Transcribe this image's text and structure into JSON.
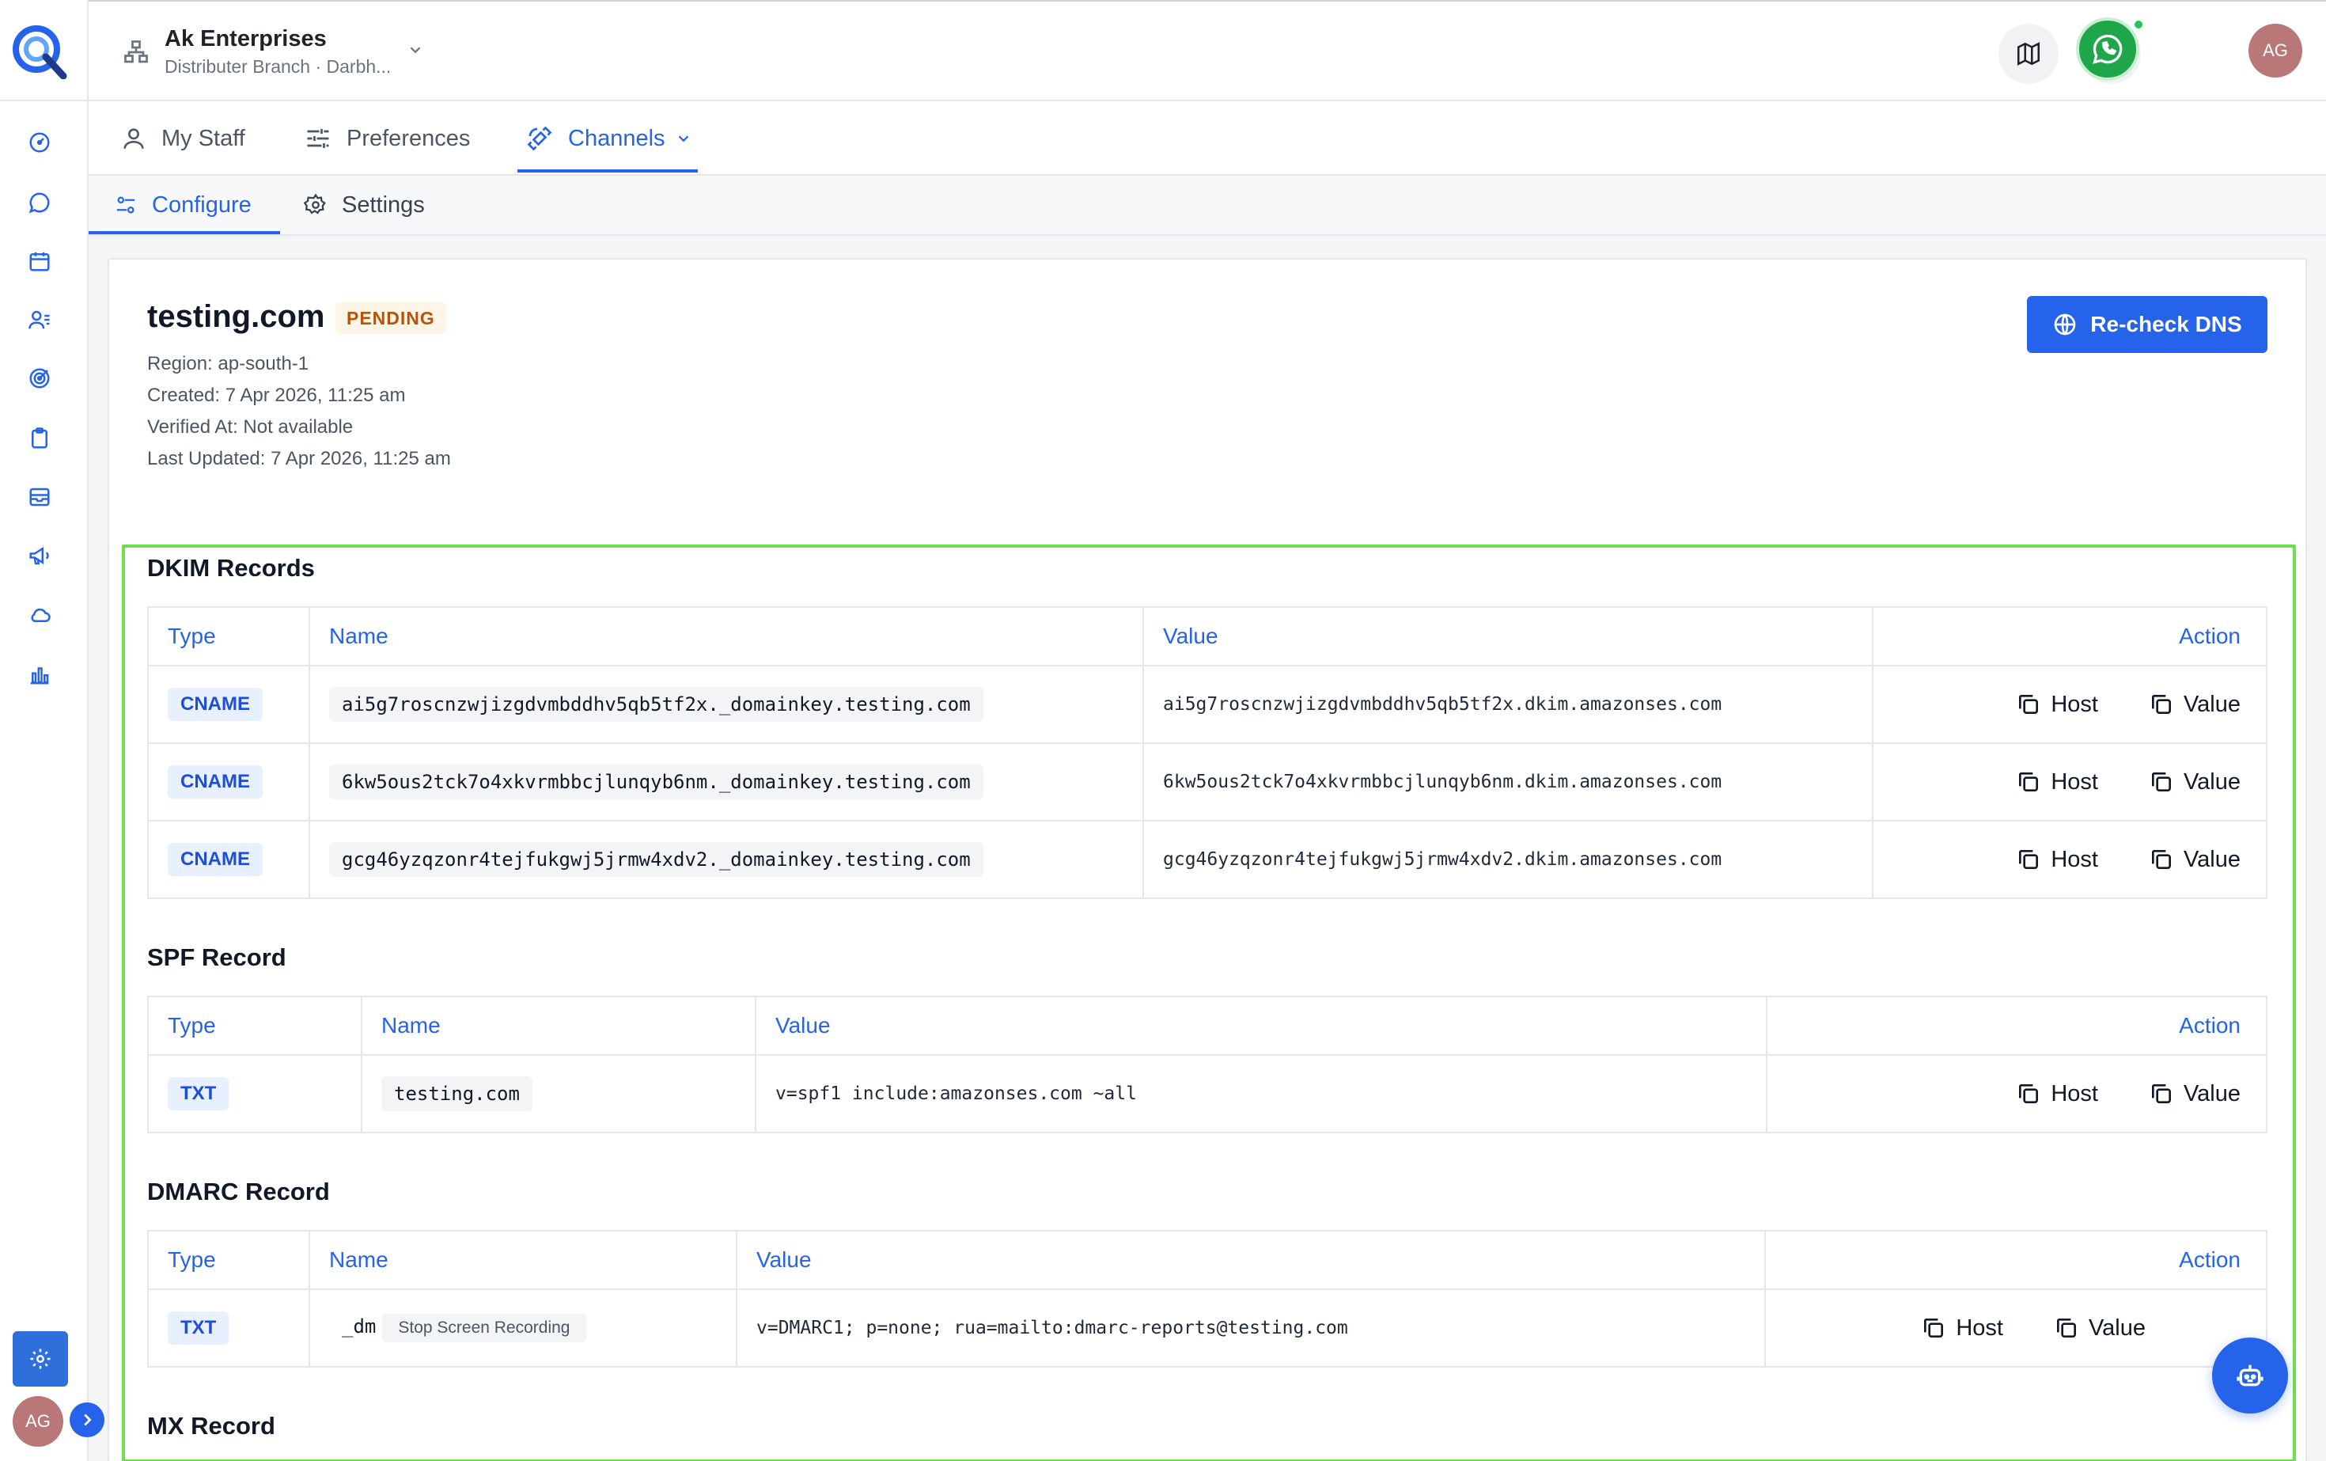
{
  "header": {
    "org_name": "Ak Enterprises",
    "org_sub": "Distributer Branch · Darbh...",
    "avatar_initials": "AG"
  },
  "sidebar": {
    "icons": [
      "dashboard-icon",
      "chat-icon",
      "calendar-icon",
      "contacts-icon",
      "target-icon",
      "clipboard-icon",
      "inbox-icon",
      "megaphone-icon",
      "cloud-icon",
      "bar-chart-icon"
    ],
    "avatar_initials": "AG"
  },
  "tabs": {
    "primary": [
      {
        "label": "My Staff",
        "icon": "user-icon"
      },
      {
        "label": "Preferences",
        "icon": "sliders-icon"
      },
      {
        "label": "Channels",
        "icon": "satellite-icon",
        "active": true
      }
    ],
    "secondary": [
      {
        "label": "Configure",
        "icon": "toggles-icon",
        "active": true
      },
      {
        "label": "Settings",
        "icon": "gear-icon"
      }
    ]
  },
  "domain": {
    "name": "testing.com",
    "status": "PENDING",
    "region": "Region: ap-south-1",
    "created": "Created: 7 Apr 2026, 11:25 am",
    "verified": "Verified At: Not available",
    "updated": "Last Updated: 7 Apr 2026, 11:25 am",
    "recheck_label": "Re-check DNS"
  },
  "columns": {
    "type": "Type",
    "name": "Name",
    "value": "Value",
    "action": "Action"
  },
  "actions": {
    "host": "Host",
    "value": "Value"
  },
  "dkim": {
    "title": "DKIM Records",
    "rows": [
      {
        "type": "CNAME",
        "name": "ai5g7roscnzwjizgdvmbddhv5qb5tf2x._domainkey.testing.com",
        "value": "ai5g7roscnzwjizgdvmbddhv5qb5tf2x.dkim.amazonses.com"
      },
      {
        "type": "CNAME",
        "name": "6kw5ous2tck7o4xkvrmbbcjlunqyb6nm._domainkey.testing.com",
        "value": "6kw5ous2tck7o4xkvrmbbcjlunqyb6nm.dkim.amazonses.com"
      },
      {
        "type": "CNAME",
        "name": "gcg46yzqzonr4tejfukgwj5jrmw4xdv2._domainkey.testing.com",
        "value": "gcg46yzqzonr4tejfukgwj5jrmw4xdv2.dkim.amazonses.com"
      }
    ]
  },
  "spf": {
    "title": "SPF Record",
    "rows": [
      {
        "type": "TXT",
        "name": "testing.com",
        "value": "v=spf1 include:amazonses.com ~all"
      }
    ]
  },
  "dmarc": {
    "title": "DMARC Record",
    "rows": [
      {
        "type": "TXT",
        "name": "_dm",
        "overlay": "Stop Screen Recording",
        "value": "v=DMARC1; p=none; rua=mailto:dmarc-reports@testing.com"
      }
    ]
  },
  "mx": {
    "title": "MX Record"
  },
  "colors": {
    "accent": "#2563eb",
    "pending": "#b45309",
    "whatsapp": "#1fa64a",
    "highlight_frame": "#6ee04d"
  }
}
